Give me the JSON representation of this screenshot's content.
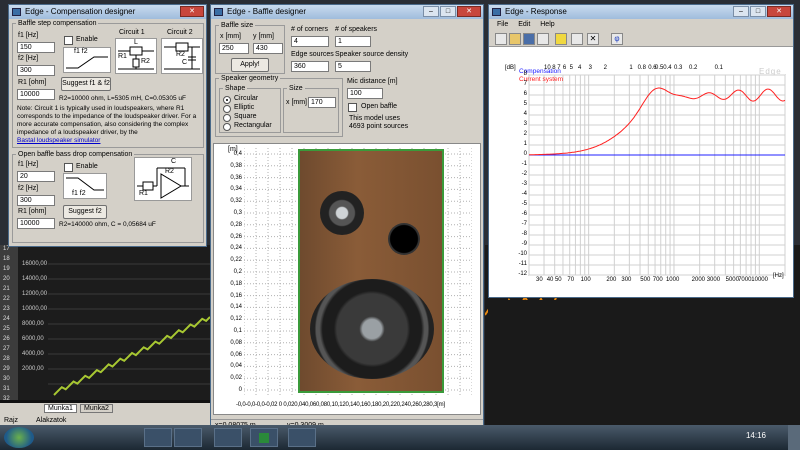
{
  "comp_window": {
    "title": "Edge - Compensation designer",
    "step_legend": "Baffle step compensation",
    "f1_label": "f1 [Hz]",
    "f1_value": "150",
    "enable_label": "Enable",
    "f2_label": "f2 [Hz]",
    "f2_value": "300",
    "f1f2_label": "f1 f2",
    "r1_label": "R1 [ohm]",
    "r1_value": "10000",
    "suggest_label": "Suggest f1 & f2",
    "circuit1_label": "Circuit 1",
    "circuit2_label": "Circuit 2",
    "result_text": "R2=10000 ohm, L=5305 mH, C=0.05305 uF",
    "note_text": "Note: Circuit 1 is typically used in loudspeakers, where R1 corresponds to the impedance of the loudspeaker driver. For a more accurate compensation, also considering the complex impedance of a loudspeaker driver, by the",
    "link_text": "Bastal loudspeaker simulator",
    "open_legend": "Open baffle bass drop compensation",
    "ob_f1_label": "f1 [Hz]",
    "ob_f1_value": "20",
    "ob_enable_label": "Enable",
    "ob_f2_label": "f2 [Hz]",
    "ob_f2_value": "300",
    "ob_f1f2_label": "f1 f2",
    "ob_r1_label": "R1 [ohm]",
    "ob_r1_value": "10000",
    "ob_suggest_label": "Suggest f2",
    "ob_result_text": "R2=140000 ohm, C = 0,05684 uF",
    "schem_labels": {
      "L": "L",
      "R1": "R1",
      "R2": "R2",
      "C": "C"
    }
  },
  "baffle_window": {
    "title": "Edge - Baffle designer",
    "size_legend": "Baffle size",
    "x_label": "x [mm]",
    "y_label": "y [mm]",
    "x_value": "250",
    "y_value": "430",
    "apply_label": "Apply!",
    "corners_label": "# of corners",
    "corners_value": "4",
    "speakers_label": "# of speakers",
    "speakers_value": "1",
    "edge_sources_label": "Edge sources",
    "edge_sources_value": "360",
    "density_label": "Speaker source density",
    "density_value": "5",
    "geometry_legend": "Speaker geometry",
    "shape_legend": "Shape",
    "shapes": [
      "Circular",
      "Elliptic",
      "Square",
      "Rectangular"
    ],
    "size_legend2": "Size",
    "size_label": "x [mm]",
    "size_value": "170",
    "mic_label": "Mic distance [m]",
    "mic_value": "100",
    "open_baffle_label": "Open baffle",
    "model_text_1": "This model uses",
    "model_text_2": "4693 point sources",
    "axis_unit": "[m]",
    "y_ticks": [
      "0,4",
      "0,38",
      "0,36",
      "0,34",
      "0,32",
      "0,3",
      "0,28",
      "0,26",
      "0,24",
      "0,22",
      "0,2",
      "0,18",
      "0,16",
      "0,14",
      "0,12",
      "0,1",
      "0,08",
      "0,06",
      "0,04",
      "0,02",
      "0"
    ],
    "x_ticks_text": "-0,0-0,0-0,0-0,02 0 0,020,040,060,080,10,120,140,160,180,20,220,240,260,280,3[m]",
    "status_x": "x=0,08075 m",
    "status_y": "y=0,3009 m"
  },
  "response_window": {
    "title": "Edge - Response",
    "menu": [
      "File",
      "Edit",
      "Help"
    ],
    "db_label": "[dB]",
    "watermark": "Edge",
    "legend_comp": "Compensation",
    "legend_curr": "Current system",
    "y_ticks": [
      "8",
      "7",
      "6",
      "5",
      "4",
      "3",
      "2",
      "1",
      "0",
      "-1",
      "-2",
      "-3",
      "-4",
      "-5",
      "-6",
      "-7",
      "-8",
      "-9",
      "-10",
      "-11",
      "-12"
    ],
    "top_ticks": [
      "10",
      "8",
      "7",
      "6",
      "5",
      "4",
      "3",
      "2",
      "1",
      "0.8",
      "0.6",
      "0.5",
      "0.4",
      "0.3",
      "0.2",
      "0.1"
    ],
    "bottom_ticks": [
      "30",
      "40",
      "50",
      "70",
      "100",
      "200",
      "300",
      "500",
      "700",
      "1000",
      "2000",
      "3000",
      "5000",
      "7000",
      "10000"
    ],
    "hz_label": "[Hz]",
    "colors": {
      "comp": "#2020ff",
      "curr": "#ff2020"
    }
  },
  "spreadsheet": {
    "row_numbers": [
      "17",
      "18",
      "19",
      "20",
      "21",
      "22",
      "23",
      "24",
      "25",
      "26",
      "27",
      "28",
      "29",
      "30",
      "31",
      "32"
    ],
    "y_labels": [
      "16000,00",
      "14000,00",
      "12000,00",
      "10000,00",
      "8000,00",
      "6000,00",
      "4000,00",
      "2000,00"
    ],
    "tabs": [
      "Munka1",
      "Munka2"
    ],
    "draw_label": "Rajz",
    "shapes_label": "Alakzatok"
  },
  "taskbar": {
    "clock": "14:16"
  }
}
